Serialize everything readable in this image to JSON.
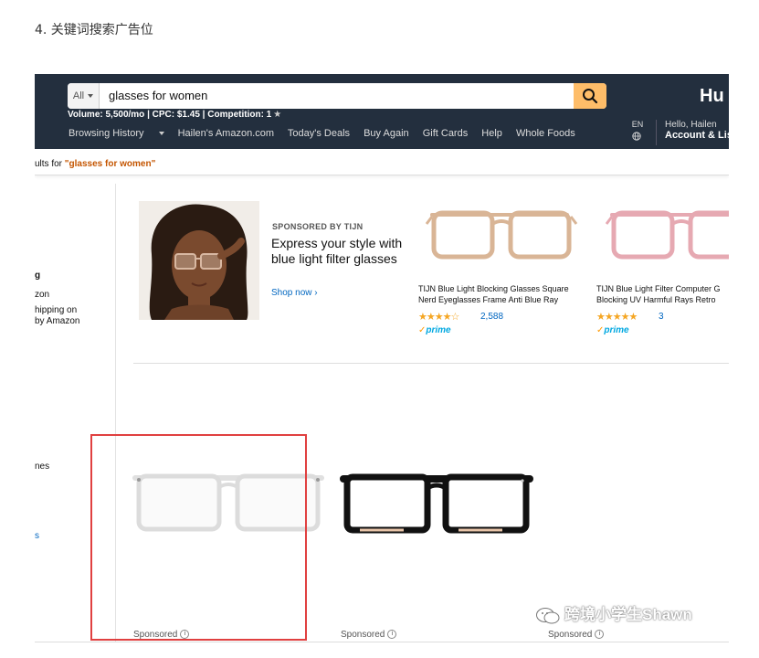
{
  "article": {
    "heading": "4. 关键词搜索广告位"
  },
  "search": {
    "department": "All",
    "query": "glasses for women",
    "keyword_stats": "Volume: 5,500/mo | CPC: $1.45 | Competition: 1",
    "stats_star": "★"
  },
  "header": {
    "brand_partial": "Hu",
    "lang": "EN",
    "hello": "Hello, Hailen",
    "account": "Account & Lis"
  },
  "nav": {
    "items": [
      "Browsing History",
      "Hailen's Amazon.com",
      "Today's Deals",
      "Buy Again",
      "Gift Cards",
      "Help",
      "Whole Foods"
    ]
  },
  "results": {
    "prefix": "ults for ",
    "query": "\"glasses for women\""
  },
  "sidebar": {
    "line1": "g",
    "line2": "zon",
    "line3": "hipping on",
    "line4": "by Amazon",
    "line5": "nes",
    "line6": "s"
  },
  "banner": {
    "sponsored_by": "SPONSORED BY TIJN",
    "headline": "Express your style with blue light filter glasses",
    "shop_now": "Shop now ›"
  },
  "banner_products": [
    {
      "title": "TIJN Blue Light Blocking Glasses Square Nerd Eyeglasses Frame Anti Blue Ray",
      "rating": 4.5,
      "stars": "★★★★☆",
      "reviews": "2,588",
      "prime": "prime",
      "frame_color": "#d9b596"
    },
    {
      "title": "TIJN Blue Light Filter Computer G Blocking UV Harmful Rays Retro",
      "rating": 4.5,
      "stars": "★★★★★",
      "reviews": "3",
      "prime": "prime",
      "frame_color": "#e6a9b2"
    }
  ],
  "results_grid": [
    {
      "sponsored": "Sponsored",
      "info": "i",
      "frame_color": "#e0e0e0"
    },
    {
      "sponsored": "Sponsored",
      "info": "i",
      "frame_color": "#111111"
    },
    {
      "sponsored": "Sponsored",
      "info": "i"
    }
  ],
  "watermark": {
    "text": "跨境小学生Shawn"
  },
  "colors": {
    "amazon_dark": "#232f3e",
    "search_button": "#febd69",
    "link": "#0066c0",
    "highlight": "#e04040",
    "prime": "#00a8e1"
  }
}
